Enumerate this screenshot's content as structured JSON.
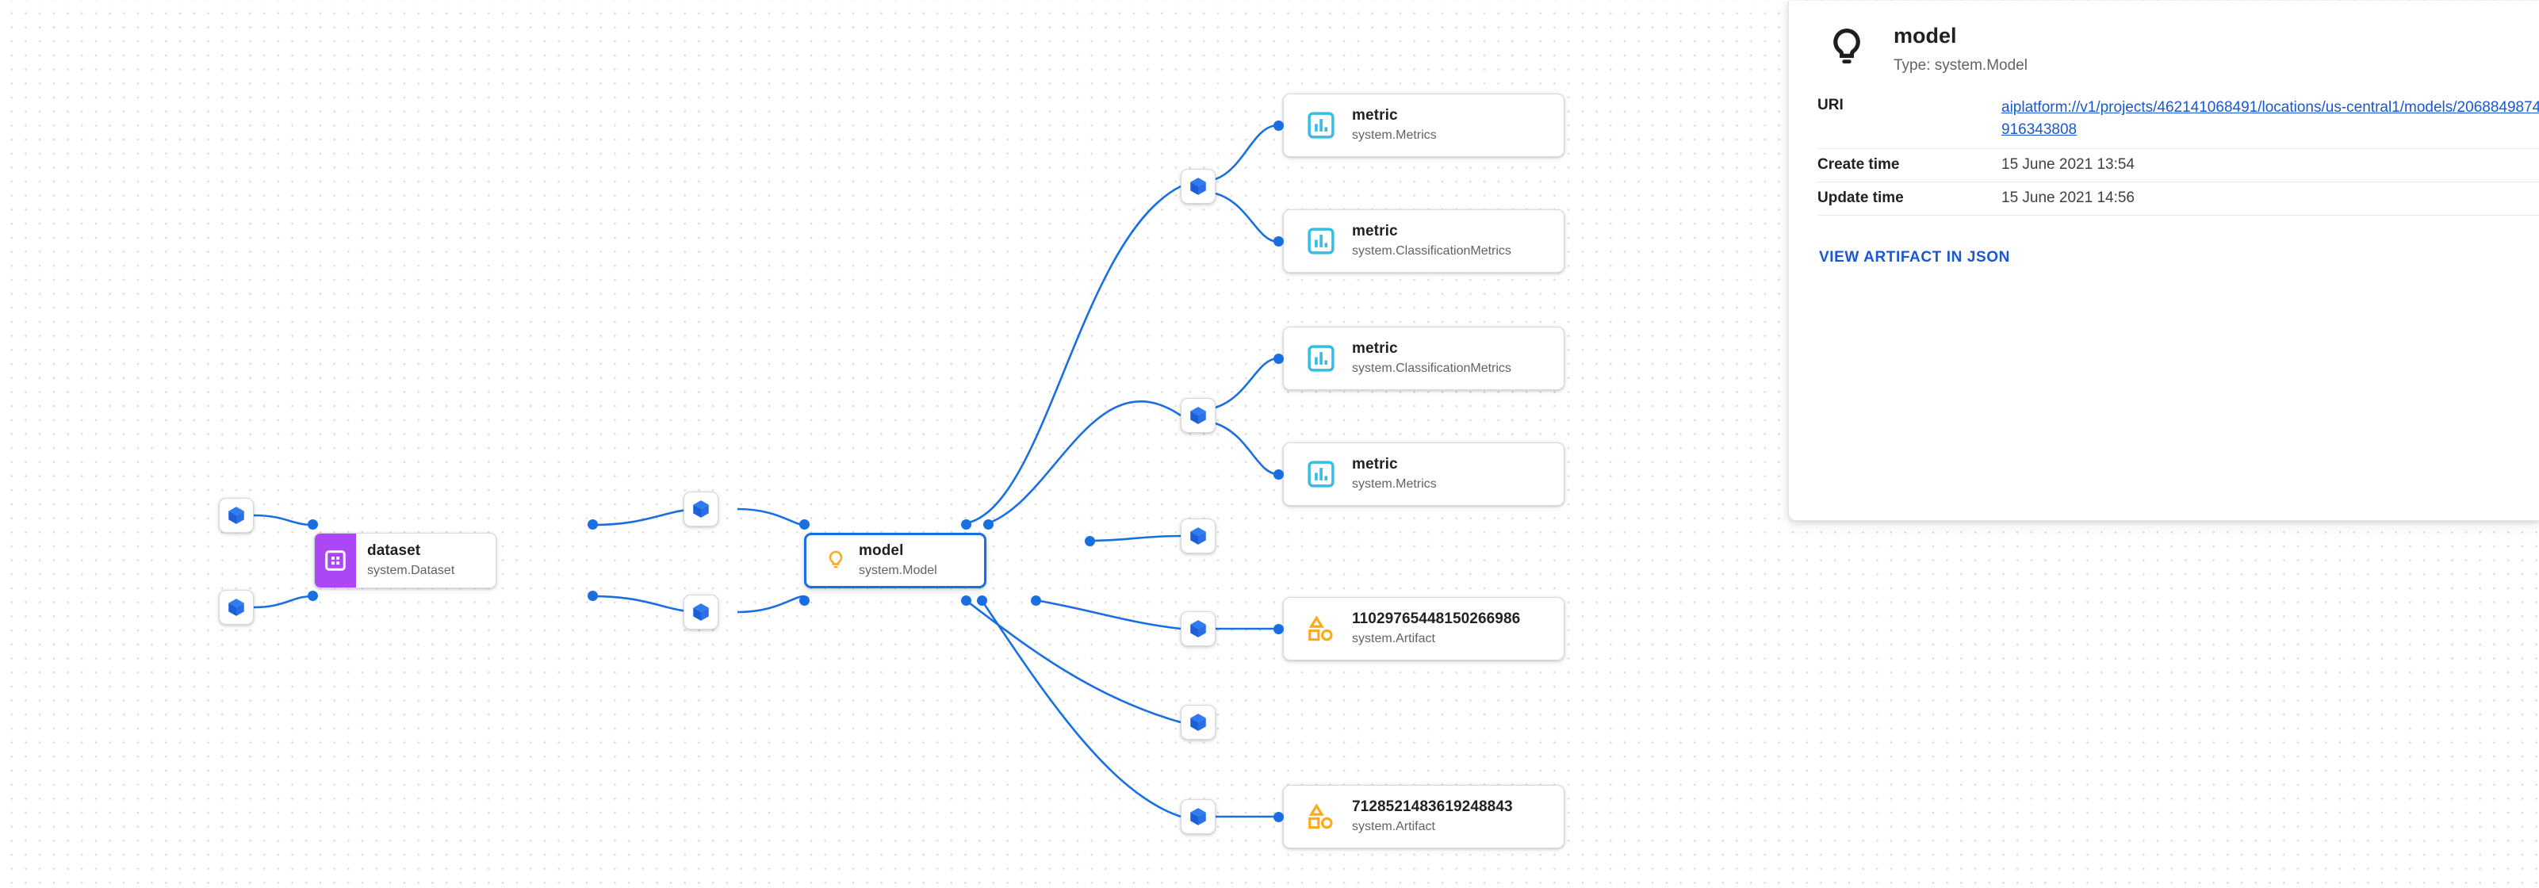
{
  "graph": {
    "nodes": [
      {
        "id": "exec-l1",
        "kind": "execution",
        "icon": "cube-icon"
      },
      {
        "id": "exec-l2",
        "kind": "execution",
        "icon": "cube-icon"
      },
      {
        "id": "dataset",
        "kind": "artifact-dataset",
        "icon": "dataset-grid-icon",
        "title": "dataset",
        "type": "system.Dataset"
      },
      {
        "id": "exec-m1",
        "kind": "execution",
        "icon": "cube-icon"
      },
      {
        "id": "exec-m2",
        "kind": "execution",
        "icon": "cube-icon"
      },
      {
        "id": "model",
        "kind": "artifact-model",
        "icon": "lightbulb-icon",
        "title": "model",
        "type": "system.Model",
        "selected": true
      },
      {
        "id": "exec-r1",
        "kind": "execution",
        "icon": "cube-icon"
      },
      {
        "id": "exec-r2",
        "kind": "execution",
        "icon": "cube-icon"
      },
      {
        "id": "exec-r3",
        "kind": "execution",
        "icon": "cube-icon"
      },
      {
        "id": "exec-r4",
        "kind": "execution",
        "icon": "cube-icon"
      },
      {
        "id": "exec-r5",
        "kind": "execution",
        "icon": "cube-icon"
      },
      {
        "id": "exec-r6",
        "kind": "execution",
        "icon": "cube-icon"
      },
      {
        "id": "metric-1",
        "kind": "artifact-metric",
        "icon": "bar-chart-icon",
        "title": "metric",
        "type": "system.Metrics"
      },
      {
        "id": "metric-2",
        "kind": "artifact-metric",
        "icon": "bar-chart-icon",
        "title": "metric",
        "type": "system.ClassificationMetrics"
      },
      {
        "id": "metric-3",
        "kind": "artifact-metric",
        "icon": "bar-chart-icon",
        "title": "metric",
        "type": "system.ClassificationMetrics"
      },
      {
        "id": "metric-4",
        "kind": "artifact-metric",
        "icon": "bar-chart-icon",
        "title": "metric",
        "type": "system.Metrics"
      },
      {
        "id": "artifact-1",
        "kind": "artifact-generic",
        "icon": "shapes-icon",
        "title": "11029765448150266986",
        "type": "system.Artifact"
      },
      {
        "id": "artifact-2",
        "kind": "artifact-generic",
        "icon": "shapes-icon",
        "title": "7128521483619248843",
        "type": "system.Artifact"
      }
    ],
    "colors": {
      "edge": "#1a6fe0",
      "anchor_dot": "#1a6fe0",
      "selected_border": "#1a6fe0",
      "dataset_block": "#AB47F5",
      "metric_icon": "#35BDE3",
      "artifact_icon": "#F9AB1E",
      "model_icon": "#F9AB1E",
      "execution_icon": "#1f6fe5",
      "grid_dot": "#dcdcdc"
    }
  },
  "panel": {
    "icon": "lightbulb-icon",
    "title": "model",
    "type_label": "Type: system.Model",
    "rows": [
      {
        "key": "URI",
        "value": "aiplatform://v1/projects/462141068491/locations/us-central1/models/2068849874916343808",
        "is_link": true
      },
      {
        "key": "Create time",
        "value": "15 June 2021 13:54",
        "is_link": false
      },
      {
        "key": "Update time",
        "value": "15 June 2021 14:56",
        "is_link": false
      }
    ],
    "action_label": "VIEW ARTIFACT IN JSON"
  }
}
